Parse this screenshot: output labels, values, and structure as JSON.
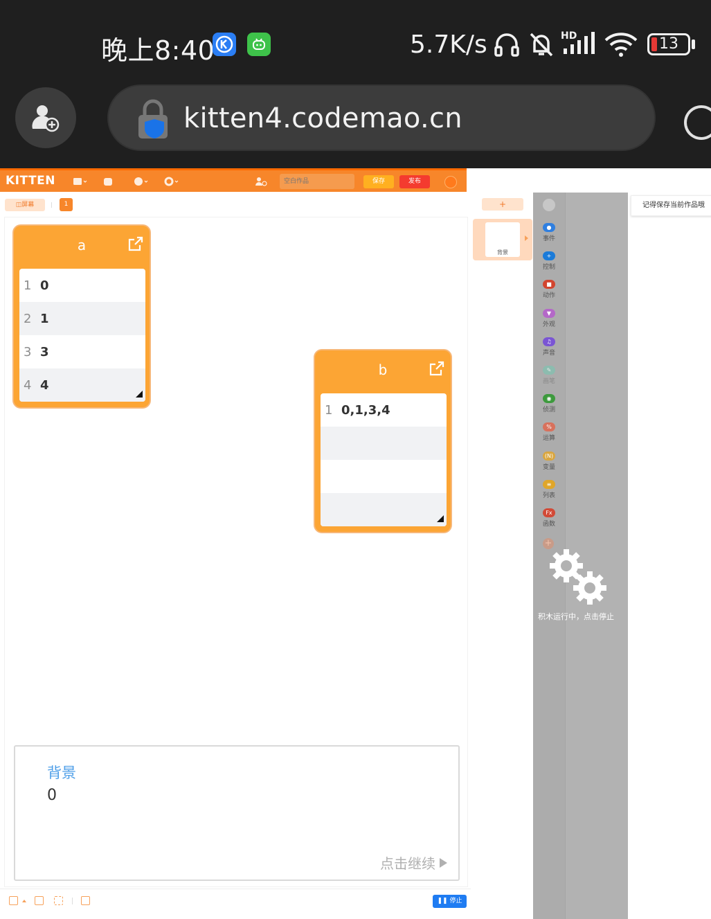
{
  "status_bar": {
    "time": "晚上8:40",
    "net_speed": "5.7K/s",
    "battery": "13",
    "signal_label": "HD"
  },
  "browser": {
    "url": "kitten4.codemao.cn"
  },
  "editor": {
    "logo": "KITTEN",
    "title_placeholder": "空白作品",
    "save_label": "保存",
    "publish_label": "发布",
    "screen_tab": "◫屏幕",
    "page_number": "1",
    "stop_label": "❚❚ 停止",
    "add_background": "+",
    "background_label": "背景",
    "save_tip": "记得保存当前作品哦",
    "running_text": "积木运行中，点击停止"
  },
  "lists": [
    {
      "name": "a",
      "rows": [
        {
          "index": "1",
          "value": "0"
        },
        {
          "index": "2",
          "value": "1"
        },
        {
          "index": "3",
          "value": "3"
        },
        {
          "index": "4",
          "value": "4"
        }
      ]
    },
    {
      "name": "b",
      "rows": [
        {
          "index": "1",
          "value": "0,1,3,4"
        }
      ]
    }
  ],
  "dialog": {
    "speaker": "背景",
    "text": "0",
    "continue_label": "点击继续"
  },
  "categories": [
    {
      "label": "事件",
      "color": "#2f7fe0",
      "glyph": "●"
    },
    {
      "label": "控制",
      "color": "#1b7bd9",
      "glyph": "+"
    },
    {
      "label": "动作",
      "color": "#d2452f",
      "glyph": "■"
    },
    {
      "label": "外观",
      "color": "#b468c8",
      "glyph": "▼"
    },
    {
      "label": "声音",
      "color": "#7a55d4",
      "glyph": "♫"
    },
    {
      "label": "画笔",
      "color": "#7fc4b1",
      "glyph": "✎"
    },
    {
      "label": "侦测",
      "color": "#3d9a3d",
      "glyph": "◉"
    },
    {
      "label": "运算",
      "color": "#d8715c",
      "glyph": "%"
    },
    {
      "label": "变量",
      "color": "#d9a640",
      "glyph": "(N)"
    },
    {
      "label": "列表",
      "color": "#e0a62a",
      "glyph": "≡"
    },
    {
      "label": "函数",
      "color": "#d24a37",
      "glyph": "Fx"
    }
  ]
}
